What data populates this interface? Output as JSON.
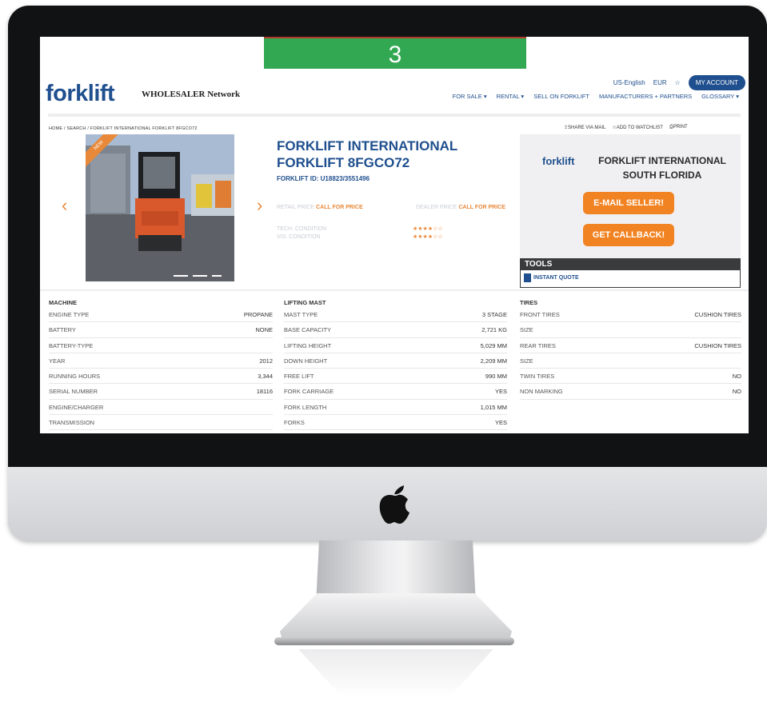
{
  "overlay": {
    "step_number": "3"
  },
  "site": {
    "logo_word": "forklift",
    "logo_partner": "WHOLESALER Network"
  },
  "header": {
    "language": "US-English",
    "currency": "EUR",
    "favorites_icon": "star-icon",
    "account_label": "MY ACCOUNT",
    "nav": [
      "FOR SALE ▾",
      "RENTAL ▾",
      "SELL ON FORKLIFT",
      "MANUFACTURERS + PARTNERS",
      "GLOSSARY ▾"
    ]
  },
  "breadcrumb": "HOME / SEARCH / FORKLIFT INTERNATIONAL FORKLIFT 8FGCO72",
  "actions": {
    "share": "SHARE VIA MAIL",
    "watchlist": "ADD TO WATCHLIST",
    "print": "PRINT"
  },
  "gallery": {
    "badge": "NEW",
    "prev_icon": "chevron-left-icon",
    "next_icon": "chevron-right-icon"
  },
  "product": {
    "title_line1": "FORKLIFT INTERNATIONAL",
    "title_line2": "FORKLIFT 8FGCO72",
    "id": "FORKLIFT ID: U18823/3551496",
    "retail_label": "RETAIL PRICE",
    "retail_value": "CALL FOR PRICE",
    "dealer_label": "DEALER PRICE",
    "dealer_value": "CALL FOR PRICE",
    "tech_condition_label": "TECH. CONDITION",
    "vis_condition_label": "VIS. CONDITION",
    "tech_condition_stars": "★★★★☆☆",
    "vis_condition_stars": "★★★★☆☆"
  },
  "seller": {
    "logo": "forklift",
    "name": "FORKLIFT INTERNATIONAL SOUTH FLORIDA",
    "email_button": "E-MAIL SELLER!",
    "callback_button": "GET CALLBACK!"
  },
  "tools": {
    "title": "TOOLS",
    "item": "INSTANT QUOTE"
  },
  "specs": {
    "machine": {
      "title": "MACHINE",
      "rows": [
        {
          "label": "ENGINE TYPE",
          "value": "PROPANE"
        },
        {
          "label": "BATTERY",
          "value": "NONE"
        },
        {
          "label": "BATTERY-TYPE",
          "value": ""
        },
        {
          "label": "YEAR",
          "value": "2012"
        },
        {
          "label": "RUNNING HOURS",
          "value": "3,344"
        },
        {
          "label": "SERIAL NUMBER",
          "value": "18116"
        },
        {
          "label": "ENGINE/CHARGER",
          "value": ""
        },
        {
          "label": "TRANSMISSION",
          "value": ""
        }
      ]
    },
    "mast": {
      "title": "LIFTING MAST",
      "rows": [
        {
          "label": "MAST TYPE",
          "value": "3 STAGE"
        },
        {
          "label": "BASE CAPACITY",
          "value": "2,721 KG"
        },
        {
          "label": "LIFTING HEIGHT",
          "value": "5,029 MM"
        },
        {
          "label": "DOWN HEIGHT",
          "value": "2,209 MM"
        },
        {
          "label": "FREE LIFT",
          "value": "990 MM"
        },
        {
          "label": "FORK CARRIAGE",
          "value": "YES"
        },
        {
          "label": "FORK LENGTH",
          "value": "1,015 MM"
        },
        {
          "label": "FORKS",
          "value": "YES"
        }
      ]
    },
    "tires": {
      "title": "TIRES",
      "rows": [
        {
          "label": "FRONT TIRES",
          "value": "CUSHION TIRES"
        },
        {
          "label": "SIZE",
          "value": ""
        },
        {
          "label": "REAR TIRES",
          "value": "CUSHION TIRES"
        },
        {
          "label": "SIZE",
          "value": ""
        },
        {
          "label": "TWIN TIRES",
          "value": "NO"
        },
        {
          "label": "NON MARKING",
          "value": "NO"
        }
      ]
    }
  },
  "colors": {
    "brand_blue": "#1f4f8e",
    "accent_orange": "#f28322",
    "banner_green": "#33a853"
  }
}
